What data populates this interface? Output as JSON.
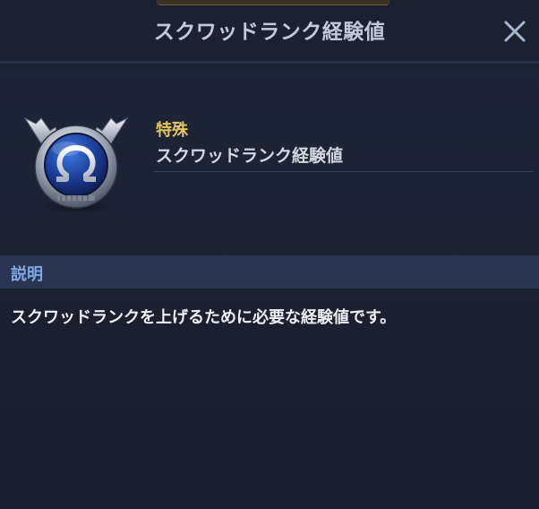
{
  "header": {
    "title": "スクワッドランク経験値",
    "close_icon": "close-icon"
  },
  "item": {
    "icon": "omega-winged-emblem-icon",
    "category": "特殊",
    "name": "スクワッドランク経験値"
  },
  "description_section": {
    "label": "説明",
    "text": "スクワッドランクを上げるために必要な経験値です。"
  },
  "colors": {
    "background": "#1c2233",
    "category": "#e6c65c",
    "section_label": "#7fa8e6",
    "section_bar": "#2b3450"
  }
}
